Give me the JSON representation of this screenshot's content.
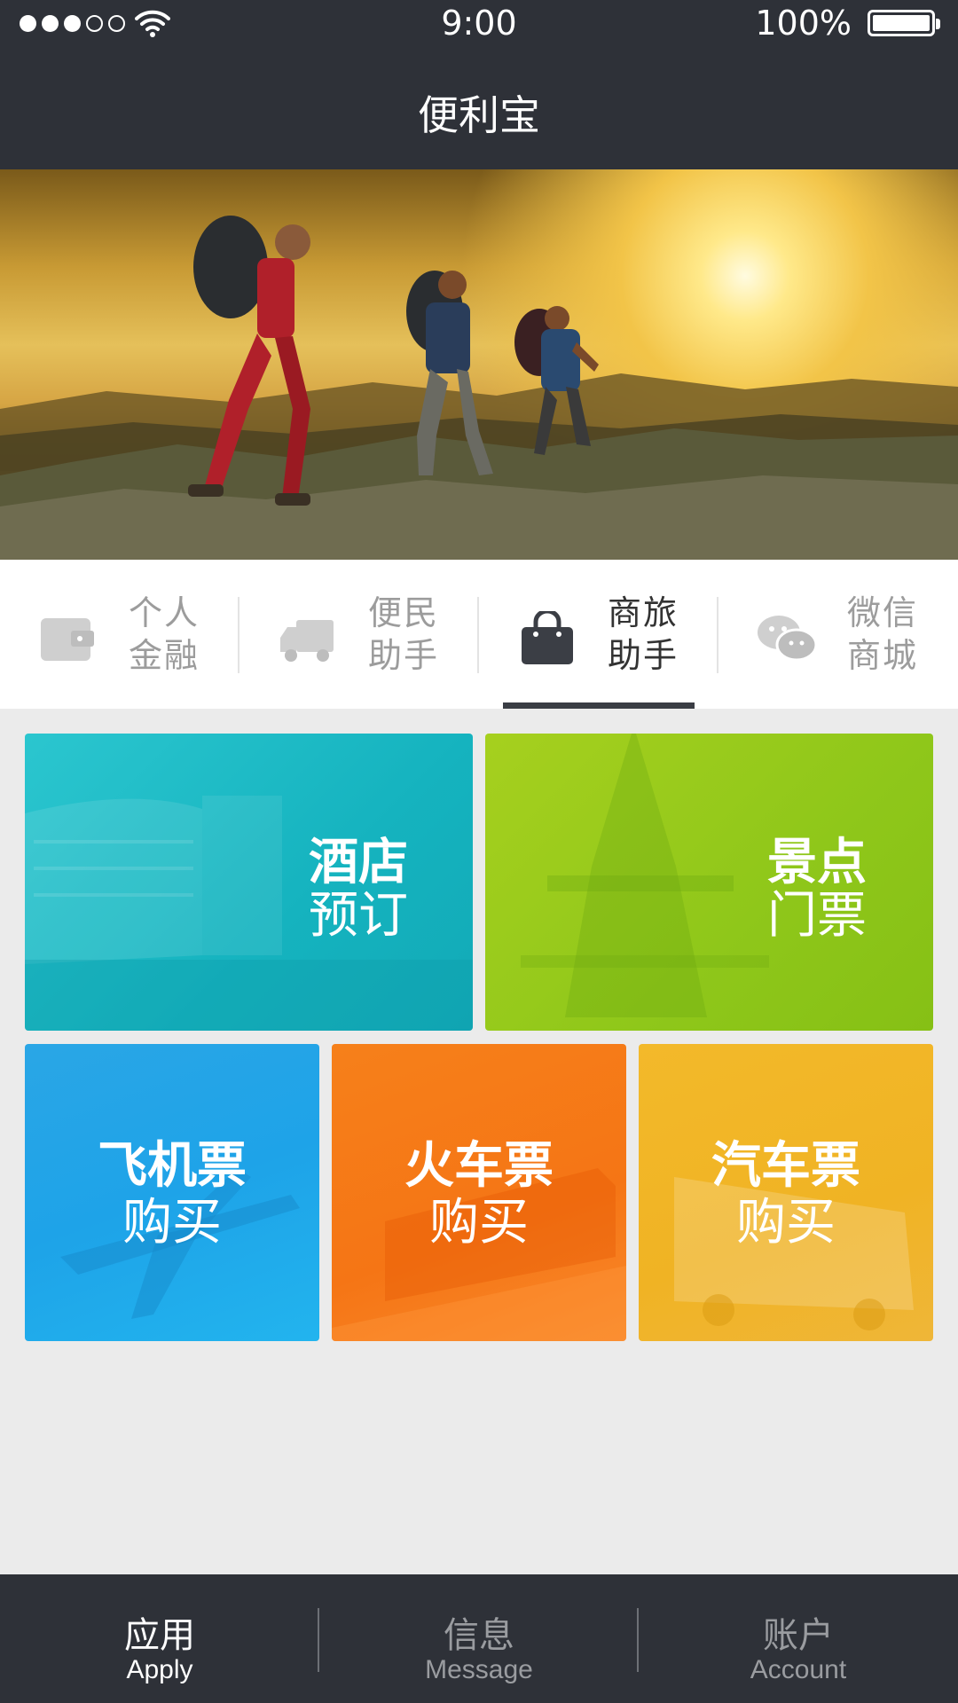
{
  "status_bar": {
    "time": "9:00",
    "battery_text": "100%",
    "signal_bars_filled": 3,
    "signal_bars_total": 5
  },
  "header": {
    "title": "便利宝"
  },
  "banner": {
    "image": "hikers-sunset-mountain"
  },
  "category_tabs": [
    {
      "line1": "个人",
      "line2": "金融",
      "icon": "wallet-icon"
    },
    {
      "line1": "便民",
      "line2": "助手",
      "icon": "truck-icon"
    },
    {
      "line1": "商旅",
      "line2": "助手",
      "icon": "shopping-bag-icon",
      "active": true
    },
    {
      "line1": "微信",
      "line2": "商城",
      "icon": "wechat-icon"
    }
  ],
  "tiles": {
    "hotel": {
      "line1": "酒店",
      "line2": "预订",
      "color": "#15b3bf"
    },
    "scenic": {
      "line1": "景点",
      "line2": "门票",
      "color": "#8fc71a"
    },
    "plane": {
      "line1": "飞机票",
      "line2": "购买",
      "color": "#1ea3e8"
    },
    "train": {
      "line1": "火车票",
      "line2": "购买",
      "color": "#f57515"
    },
    "bus": {
      "line1": "汽车票",
      "line2": "购买",
      "color": "#f0b324"
    }
  },
  "bottom_nav": [
    {
      "zh": "应用",
      "en": "Apply",
      "active": true
    },
    {
      "zh": "信息",
      "en": "Message"
    },
    {
      "zh": "账户",
      "en": "Account"
    }
  ],
  "colors": {
    "bar": "#2e3138",
    "page_bg": "#ebebeb"
  }
}
